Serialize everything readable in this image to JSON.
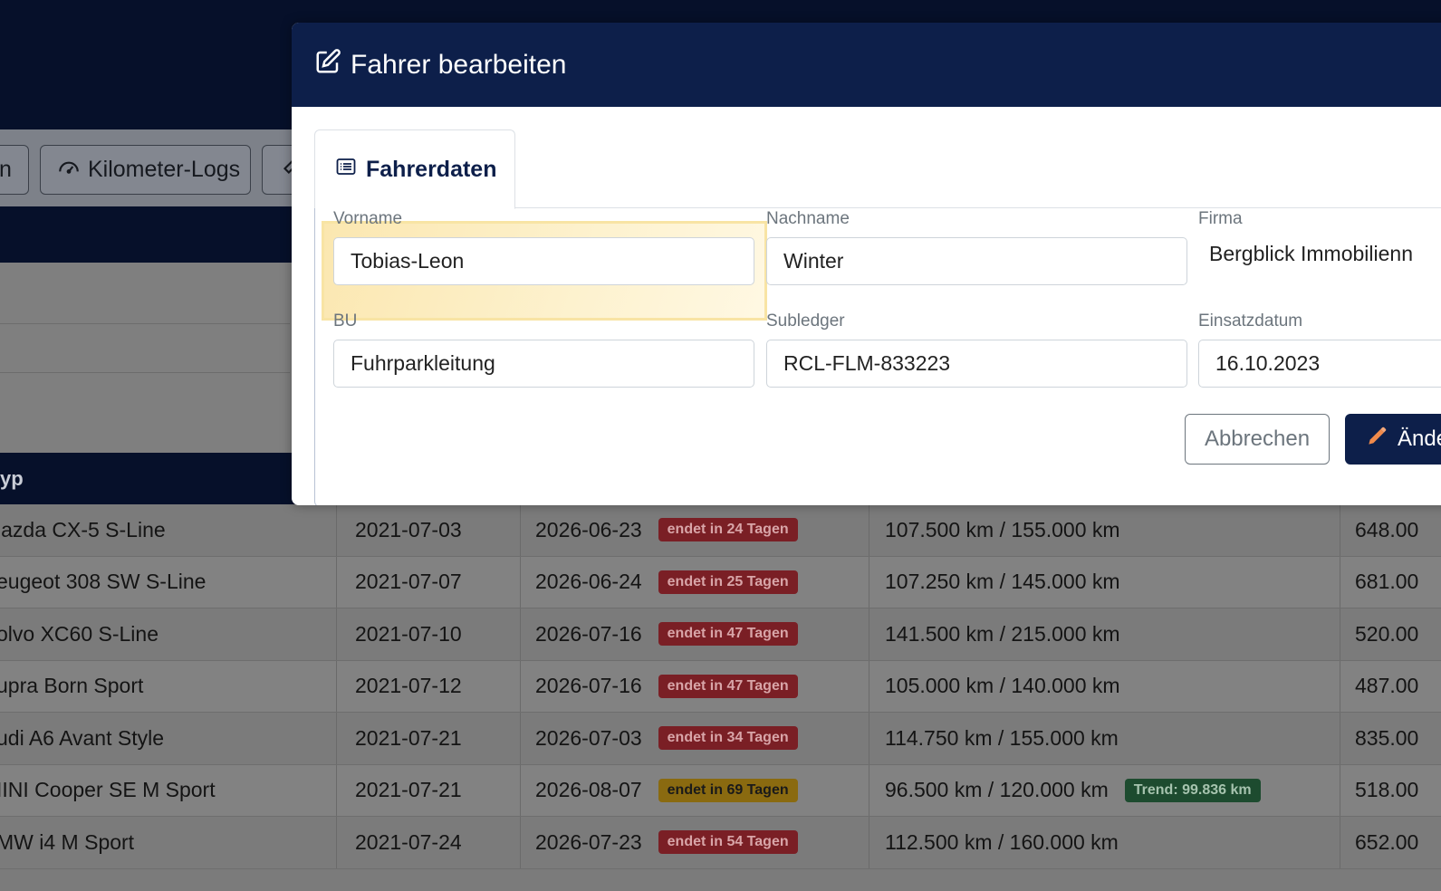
{
  "toolbar": {
    "partial_button": "n",
    "km_logs_label": "Kilometer-Logs"
  },
  "table": {
    "partial_header": "yp",
    "rows": [
      {
        "model": "lazda CX-5 S-Line",
        "start": "2021-07-03",
        "end": "2026-06-23",
        "badge": "endet in 24 Tagen",
        "km": "107.500 km / 155.000 km",
        "rate": "648.00"
      },
      {
        "model": "eugeot 308 SW S-Line",
        "start": "2021-07-07",
        "end": "2026-06-24",
        "badge": "endet in 25 Tagen",
        "km": "107.250 km / 145.000 km",
        "rate": "681.00"
      },
      {
        "model": "olvo XC60 S-Line",
        "start": "2021-07-10",
        "end": "2026-07-16",
        "badge": "endet in 47 Tagen",
        "km": "141.500 km / 215.000 km",
        "rate": "520.00"
      },
      {
        "model": "upra Born Sport",
        "start": "2021-07-12",
        "end": "2026-07-16",
        "badge": "endet in 47 Tagen",
        "km": "105.000 km / 140.000 km",
        "rate": "487.00"
      },
      {
        "model": "udi A6 Avant Style",
        "start": "2021-07-21",
        "end": "2026-07-03",
        "badge": "endet in 34 Tagen",
        "km": "114.750 km / 155.000 km",
        "rate": "835.00"
      },
      {
        "model": "IINI Cooper SE M Sport",
        "start": "2021-07-21",
        "end": "2026-08-07",
        "badge": "endet in 69 Tagen",
        "km": "96.500 km / 120.000 km",
        "trend": "Trend: 99.836 km",
        "rate": "518.00"
      },
      {
        "model": "MW i4 M Sport",
        "start": "2021-07-24",
        "end": "2026-07-23",
        "badge": "endet in 54 Tagen",
        "km": "112.500 km / 160.000 km",
        "rate": "652.00"
      }
    ]
  },
  "modal": {
    "title": "Fahrer bearbeiten",
    "tab_label": "Fahrerdaten",
    "fields": {
      "vorname": {
        "label": "Vorname",
        "value": "Tobias-Leon"
      },
      "nachname": {
        "label": "Nachname",
        "value": "Winter"
      },
      "firma": {
        "label": "Firma",
        "value": "Bergblick Immobilienn"
      },
      "bu": {
        "label": "BU",
        "value": "Fuhrparkleitung"
      },
      "subledger": {
        "label": "Subledger",
        "value": "RCL-FLM-833223"
      },
      "einsatzdatum": {
        "label": "Einsatzdatum",
        "value": "16.10.2023"
      }
    },
    "cancel_label": "Abbrechen",
    "save_label": "Ände"
  },
  "colors": {
    "header_navy": "#0d1f4a",
    "badge_red": "#7a1f25",
    "badge_yellow": "#8a6a10",
    "badge_green": "#1d4b2f",
    "highlight": "#fbe7b0"
  }
}
